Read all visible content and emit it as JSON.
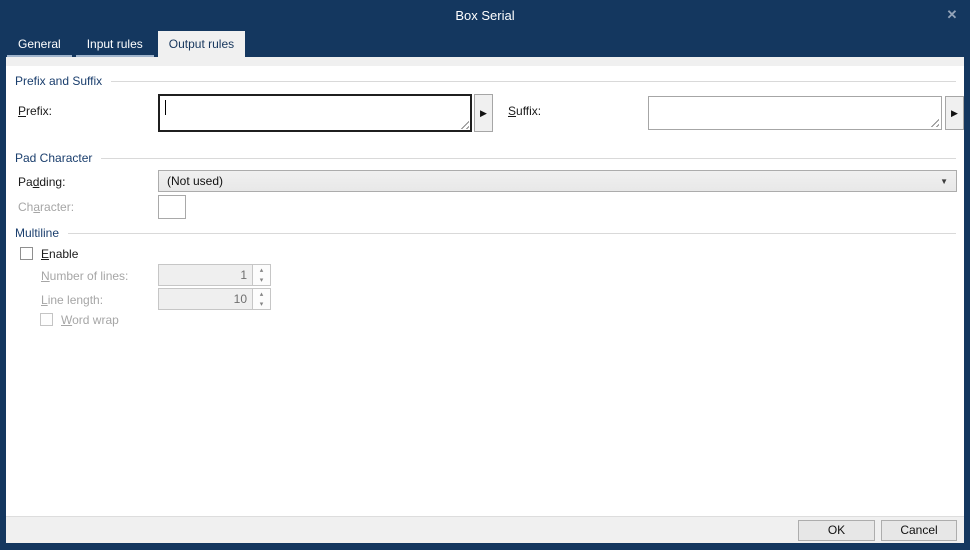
{
  "window": {
    "title": "Box Serial",
    "close_icon": "✕"
  },
  "tabs": {
    "general": "General",
    "input_rules": "Input rules",
    "output_rules": "Output rules"
  },
  "prefix_suffix": {
    "title": "Prefix and Suffix",
    "prefix_label": {
      "text": "Prefix:",
      "accel": 0
    },
    "prefix_value": "",
    "suffix_label": {
      "text": "Suffix:",
      "accel": 0
    },
    "suffix_value": "",
    "picker_arrow": "▶"
  },
  "pad_character": {
    "title": "Pad Character",
    "padding_label": {
      "text": "Padding:",
      "accel": 2
    },
    "padding_value": "(Not used)",
    "dropdown_arrow": "▼",
    "character_label": {
      "text": "Character:",
      "accel": 2
    },
    "character_value": ""
  },
  "multiline": {
    "title": "Multiline",
    "enable_label": {
      "text": "Enable",
      "accel": 0
    },
    "enable_checked": false,
    "number_of_lines_label": {
      "text": "Number of lines:",
      "accel": 0
    },
    "number_of_lines_value": "1",
    "line_length_label": {
      "text": "Line length:",
      "accel": 0
    },
    "line_length_value": "10",
    "word_wrap_label": {
      "text": "Word wrap",
      "accel": 0
    },
    "word_wrap_checked": false,
    "spin_up": "▴",
    "spin_down": "▾"
  },
  "footer": {
    "ok_label": "OK",
    "cancel_label": "Cancel"
  },
  "colors": {
    "titlebar_navy": "#14375F",
    "active_tab_bg": "#F0F0F0",
    "inactive_tab_underline": "#9FB4CC",
    "section_title": "#1A3E6D",
    "disabled_text": "#A6A6A6",
    "footer_bg": "#F0F0F0",
    "button_bg": "#E7E7E7",
    "button_border": "#ADADAD"
  }
}
